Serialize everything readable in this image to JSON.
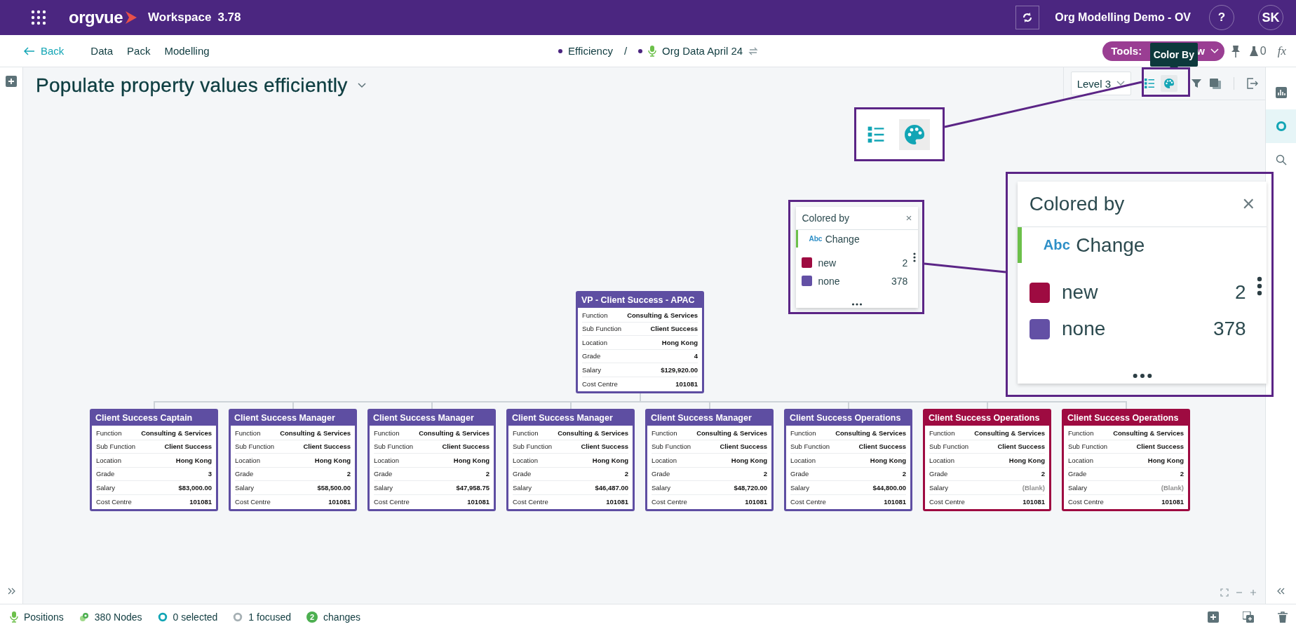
{
  "top_bar": {
    "app_name": "orgvue",
    "workspace_label": "Workspace",
    "version": "3.78",
    "project": "Org Modelling Demo - OV",
    "help": "?",
    "user_initials": "SK"
  },
  "nav": {
    "back": "Back",
    "links": [
      "Data",
      "Pack",
      "Modelling"
    ],
    "breadcrumbs": [
      {
        "label": "Efficiency",
        "kind": "dot"
      },
      {
        "label": "Org Data April 24",
        "kind": "dataset"
      }
    ],
    "separator": "/",
    "tools_label": "Tools:",
    "tools_value_visible": "w",
    "tooltip": "Color By",
    "flask_count": "0",
    "formula": "fx"
  },
  "page_title": "Populate property values efficiently",
  "toolbar": {
    "level": "Level 3"
  },
  "right_rail": [
    {
      "kind": "chart",
      "selected": false
    },
    {
      "kind": "ring",
      "selected": true
    },
    {
      "kind": "search",
      "selected": false
    }
  ],
  "legend": {
    "title": "Colored by",
    "close": "×",
    "property_type": "Abc",
    "property": "Change",
    "items": [
      {
        "label": "new",
        "count": "2",
        "color": "#9e0b41"
      },
      {
        "label": "none",
        "count": "378",
        "color": "#6350a5"
      }
    ]
  },
  "legend_zoom": {
    "title": "Colored by",
    "close": "×",
    "property_type": "Abc",
    "property": "Change",
    "items": [
      {
        "label": "new",
        "count": "2",
        "color": "#9e0b41"
      },
      {
        "label": "none",
        "count": "378",
        "color": "#6350a5"
      }
    ]
  },
  "org_chart": {
    "root": {
      "title": "VP - Client Success - APAC",
      "color": "#5e4ea2",
      "fields": [
        {
          "label": "Function",
          "value": "Consulting & Services",
          "blank": false
        },
        {
          "label": "Sub Function",
          "value": "Client Success",
          "blank": false
        },
        {
          "label": "Location",
          "value": "Hong Kong",
          "blank": false
        },
        {
          "label": "Grade",
          "value": "4",
          "blank": false
        },
        {
          "label": "Salary",
          "value": "$129,920.00",
          "blank": false
        },
        {
          "label": "Cost Centre",
          "value": "101081",
          "blank": false
        }
      ]
    },
    "children": [
      {
        "title": "Client Success Captain",
        "color": "#5e4ea2",
        "fields": [
          {
            "label": "Function",
            "value": "Consulting & Services",
            "blank": false
          },
          {
            "label": "Sub Function",
            "value": "Client Success",
            "blank": false
          },
          {
            "label": "Location",
            "value": "Hong Kong",
            "blank": false
          },
          {
            "label": "Grade",
            "value": "3",
            "blank": false
          },
          {
            "label": "Salary",
            "value": "$83,000.00",
            "blank": false
          },
          {
            "label": "Cost Centre",
            "value": "101081",
            "blank": false
          }
        ]
      },
      {
        "title": "Client Success Manager",
        "color": "#5e4ea2",
        "fields": [
          {
            "label": "Function",
            "value": "Consulting & Services",
            "blank": false
          },
          {
            "label": "Sub Function",
            "value": "Client Success",
            "blank": false
          },
          {
            "label": "Location",
            "value": "Hong Kong",
            "blank": false
          },
          {
            "label": "Grade",
            "value": "2",
            "blank": false
          },
          {
            "label": "Salary",
            "value": "$58,500.00",
            "blank": false
          },
          {
            "label": "Cost Centre",
            "value": "101081",
            "blank": false
          }
        ]
      },
      {
        "title": "Client Success Manager",
        "color": "#5e4ea2",
        "fields": [
          {
            "label": "Function",
            "value": "Consulting & Services",
            "blank": false
          },
          {
            "label": "Sub Function",
            "value": "Client Success",
            "blank": false
          },
          {
            "label": "Location",
            "value": "Hong Kong",
            "blank": false
          },
          {
            "label": "Grade",
            "value": "2",
            "blank": false
          },
          {
            "label": "Salary",
            "value": "$47,958.75",
            "blank": false
          },
          {
            "label": "Cost Centre",
            "value": "101081",
            "blank": false
          }
        ]
      },
      {
        "title": "Client Success Manager",
        "color": "#5e4ea2",
        "fields": [
          {
            "label": "Function",
            "value": "Consulting & Services",
            "blank": false
          },
          {
            "label": "Sub Function",
            "value": "Client Success",
            "blank": false
          },
          {
            "label": "Location",
            "value": "Hong Kong",
            "blank": false
          },
          {
            "label": "Grade",
            "value": "2",
            "blank": false
          },
          {
            "label": "Salary",
            "value": "$46,487.00",
            "blank": false
          },
          {
            "label": "Cost Centre",
            "value": "101081",
            "blank": false
          }
        ]
      },
      {
        "title": "Client Success Manager",
        "color": "#5e4ea2",
        "fields": [
          {
            "label": "Function",
            "value": "Consulting & Services",
            "blank": false
          },
          {
            "label": "Sub Function",
            "value": "Client Success",
            "blank": false
          },
          {
            "label": "Location",
            "value": "Hong Kong",
            "blank": false
          },
          {
            "label": "Grade",
            "value": "2",
            "blank": false
          },
          {
            "label": "Salary",
            "value": "$48,720.00",
            "blank": false
          },
          {
            "label": "Cost Centre",
            "value": "101081",
            "blank": false
          }
        ]
      },
      {
        "title": "Client Success Operations",
        "color": "#5e4ea2",
        "fields": [
          {
            "label": "Function",
            "value": "Consulting & Services",
            "blank": false
          },
          {
            "label": "Sub Function",
            "value": "Client Success",
            "blank": false
          },
          {
            "label": "Location",
            "value": "Hong Kong",
            "blank": false
          },
          {
            "label": "Grade",
            "value": "2",
            "blank": false
          },
          {
            "label": "Salary",
            "value": "$44,800.00",
            "blank": false
          },
          {
            "label": "Cost Centre",
            "value": "101081",
            "blank": false
          }
        ]
      },
      {
        "title": "Client Success Operations",
        "color": "#9e0b41",
        "fields": [
          {
            "label": "Function",
            "value": "Consulting & Services",
            "blank": false
          },
          {
            "label": "Sub Function",
            "value": "Client Success",
            "blank": false
          },
          {
            "label": "Location",
            "value": "Hong Kong",
            "blank": false
          },
          {
            "label": "Grade",
            "value": "2",
            "blank": false
          },
          {
            "label": "Salary",
            "value": "(Blank)",
            "blank": true
          },
          {
            "label": "Cost Centre",
            "value": "101081",
            "blank": false
          }
        ]
      },
      {
        "title": "Client Success Operations",
        "color": "#9e0b41",
        "fields": [
          {
            "label": "Function",
            "value": "Consulting & Services",
            "blank": false
          },
          {
            "label": "Sub Function",
            "value": "Client Success",
            "blank": false
          },
          {
            "label": "Location",
            "value": "Hong Kong",
            "blank": false
          },
          {
            "label": "Grade",
            "value": "2",
            "blank": false
          },
          {
            "label": "Salary",
            "value": "(Blank)",
            "blank": true
          },
          {
            "label": "Cost Centre",
            "value": "101081",
            "blank": false
          }
        ]
      }
    ]
  },
  "status_bar": {
    "items": [
      {
        "kind": "positions",
        "label": "Positions"
      },
      {
        "kind": "nodes",
        "label": "380 Nodes"
      },
      {
        "kind": "selected",
        "label": "0 selected"
      },
      {
        "kind": "focused",
        "label": "1 focused"
      },
      {
        "kind": "changes",
        "badge": "2",
        "label": "changes"
      }
    ]
  }
}
